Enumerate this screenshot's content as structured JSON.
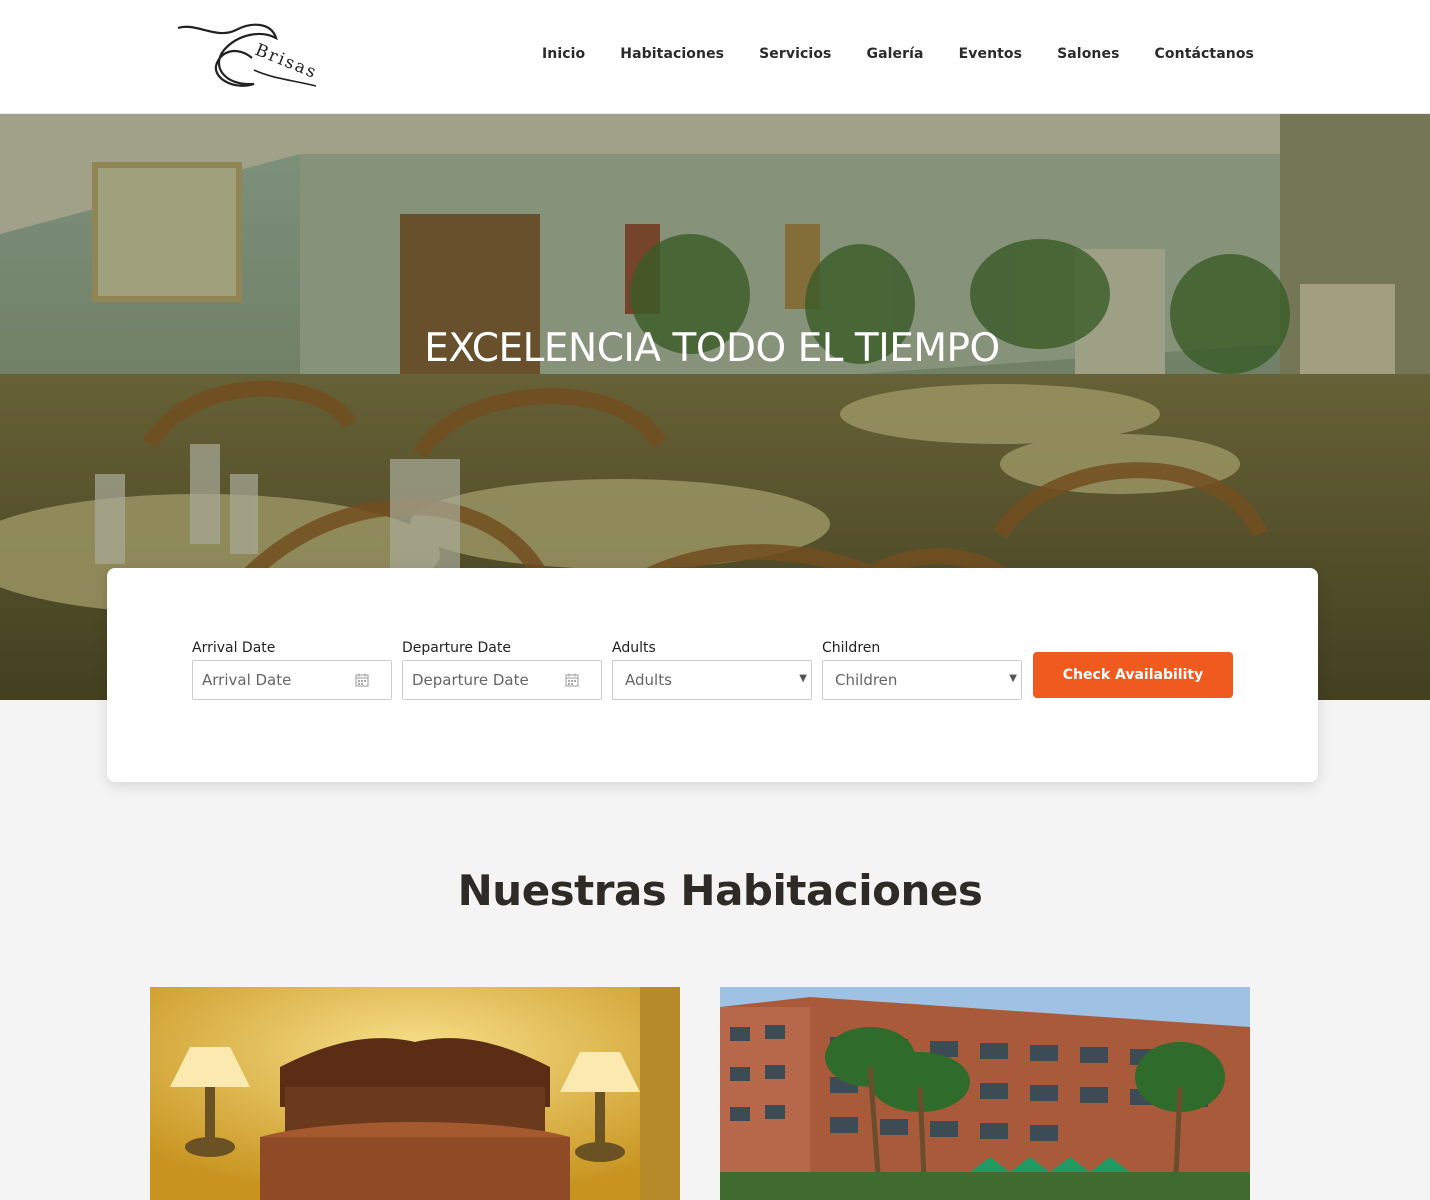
{
  "brand": {
    "logo_text": "Brisas"
  },
  "nav": {
    "items": [
      {
        "label": "Inicio"
      },
      {
        "label": "Habitaciones"
      },
      {
        "label": "Servicios"
      },
      {
        "label": "Galería"
      },
      {
        "label": "Eventos"
      },
      {
        "label": "Salones"
      },
      {
        "label": "Contáctanos"
      }
    ]
  },
  "hero": {
    "title": "EXCELENCIA TODO EL TIEMPO"
  },
  "booking": {
    "arrival": {
      "label": "Arrival Date",
      "placeholder": "Arrival Date"
    },
    "departure": {
      "label": "Departure Date",
      "placeholder": "Departure Date"
    },
    "adults": {
      "label": "Adults",
      "selected": "Adults"
    },
    "children": {
      "label": "Children",
      "selected": "Children"
    },
    "submit_label": "Check Availability",
    "accent_color": "#f05a1e"
  },
  "rooms": {
    "title": "Nuestras Habitaciones"
  }
}
